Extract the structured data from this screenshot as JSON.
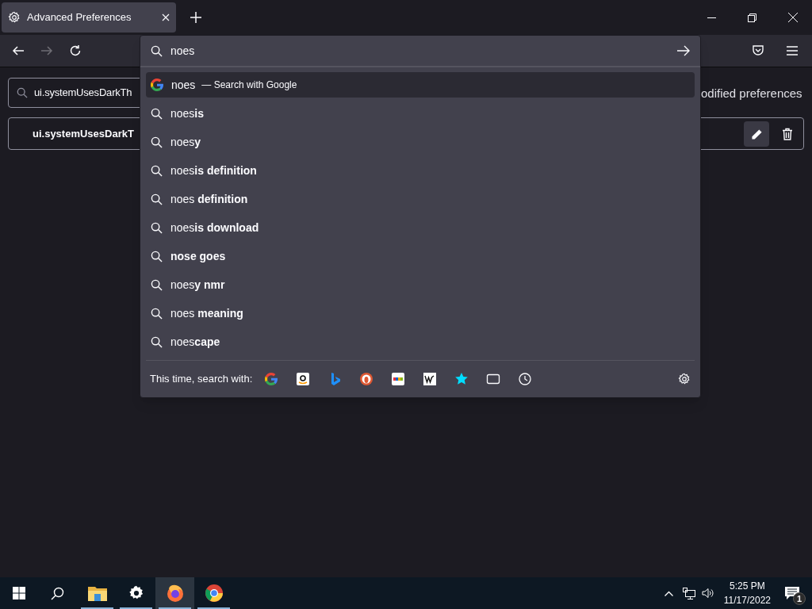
{
  "tab": {
    "title": "Advanced Preferences",
    "selected": true
  },
  "address_bar": {
    "value": "noes"
  },
  "page": {
    "search": {
      "value": "ui.systemUsesDarkTh"
    },
    "toggle_label": "odified preferences",
    "pref_row": {
      "name": "ui.systemUsesDarkT"
    }
  },
  "suggestions": [
    {
      "kind": "engine",
      "text": "noes",
      "action": "— Search with Google",
      "selected": true
    },
    {
      "kind": "search",
      "text": "noes**is**",
      "selected": false
    },
    {
      "kind": "search",
      "text": "noes**y**",
      "selected": false
    },
    {
      "kind": "search",
      "text": "noes**is definition**",
      "selected": false
    },
    {
      "kind": "search",
      "text": "noes **definition**",
      "selected": false
    },
    {
      "kind": "search",
      "text": "noes**is download**",
      "selected": false
    },
    {
      "kind": "search",
      "text": "**nose goes**",
      "selected": false
    },
    {
      "kind": "search",
      "text": "noes**y nmr**",
      "selected": false
    },
    {
      "kind": "search",
      "text": "noes **meaning**",
      "selected": false
    },
    {
      "kind": "search",
      "text": "noes**cape**",
      "selected": false
    }
  ],
  "one_off": {
    "label": "This time, search with:"
  },
  "taskbar": {
    "apps": [
      {
        "kind": "explorer",
        "open": true,
        "selected": false
      },
      {
        "kind": "settings",
        "open": true,
        "selected": false
      },
      {
        "kind": "firefox",
        "open": true,
        "selected": true
      },
      {
        "kind": "chrome",
        "open": true,
        "selected": false
      }
    ],
    "time": "5:25 PM",
    "date": "11/17/2022",
    "notifications": "1"
  }
}
